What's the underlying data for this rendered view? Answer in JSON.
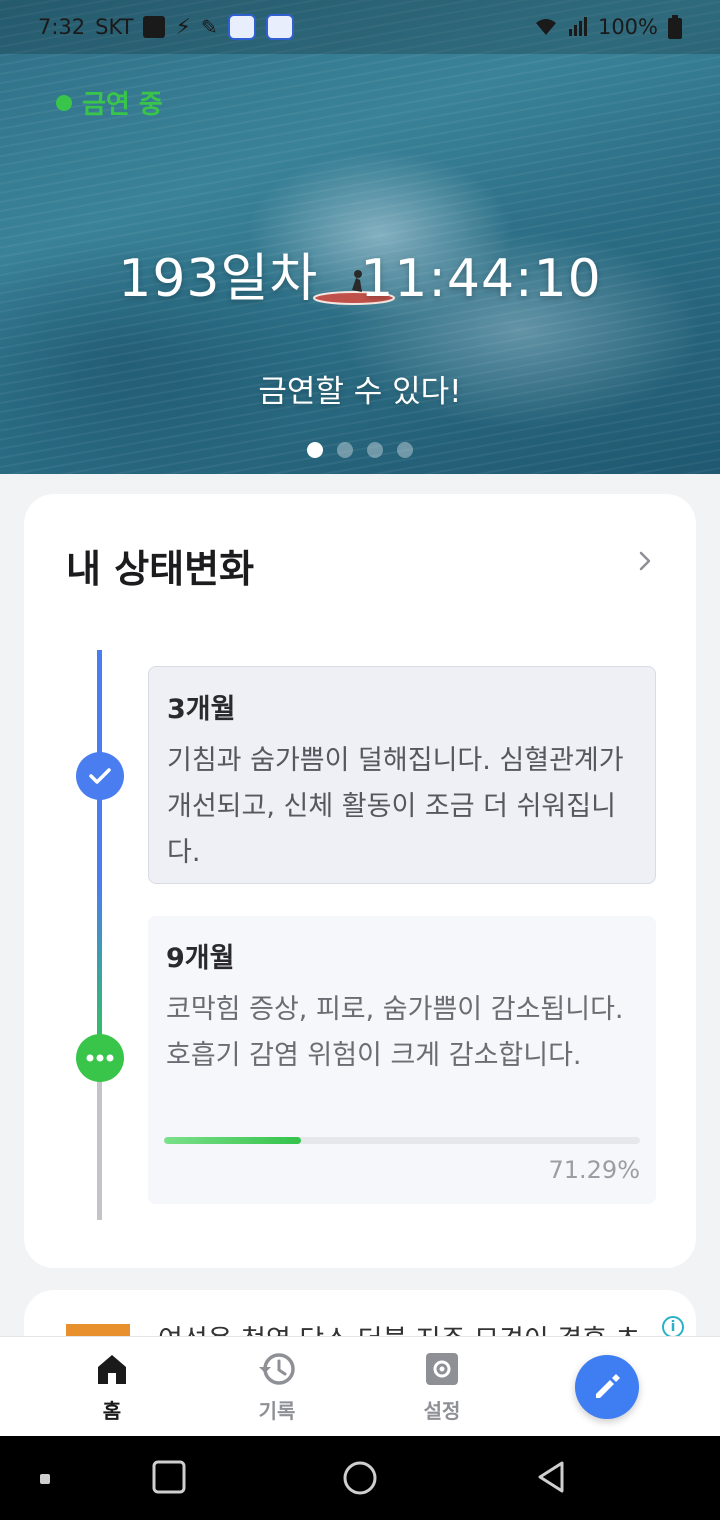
{
  "statusbar": {
    "time": "7:32",
    "carrier": "SKT",
    "battery": "100%"
  },
  "hero": {
    "status_label": "금연 중",
    "day_count": "193일차",
    "timer": "11:44:10",
    "motto": "금연할 수 있다!",
    "page_count": 4,
    "active_page": 1
  },
  "progress_card": {
    "title": "내 상태변화",
    "stages": [
      {
        "title": "3개월",
        "description": "기침과 숨가쁨이 덜해집니다. 심혈관계가 개선되고, 신체 활동이 조금 더 쉬워집니다.",
        "status": "completed"
      },
      {
        "title": "9개월",
        "description": "코막힘 증상, 피로, 숨가쁨이 감소됩니다. 호흡기 감염 위험이 크게 감소합니다.",
        "status": "in-progress",
        "progress_text": "71.29%",
        "progress_fraction": 0.2871
      }
    ]
  },
  "ad": {
    "text": "여성용 청역 당소 더블 지주 모견이 결혼 초"
  },
  "bottom_nav": {
    "items": [
      {
        "label": "홈",
        "icon": "home-icon",
        "active": true
      },
      {
        "label": "기록",
        "icon": "history-icon",
        "active": false
      },
      {
        "label": "설정",
        "icon": "gear-icon",
        "active": false
      }
    ],
    "fab_icon": "pencil-icon"
  },
  "colors": {
    "accent_blue": "#4a7df0",
    "accent_green": "#38c54a",
    "fab": "#3f7df2"
  }
}
